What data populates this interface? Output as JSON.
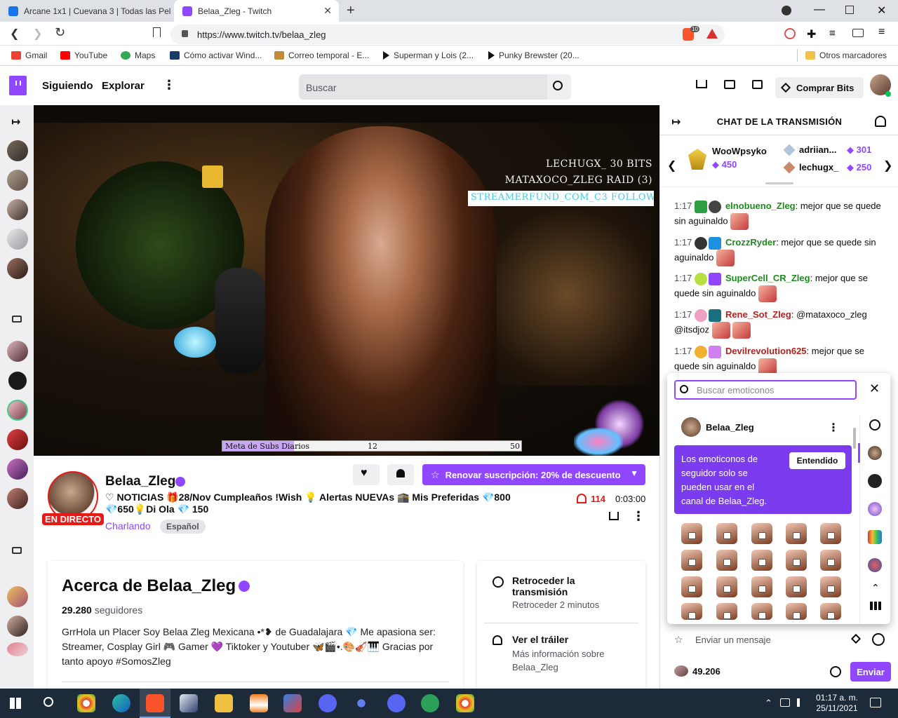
{
  "browser": {
    "tabs": [
      {
        "title": "Arcane 1x1 | Cuevana 3 | Todas las Pel"
      },
      {
        "title": "Belaa_Zleg - Twitch"
      }
    ],
    "url": "https://www.twitch.tv/belaa_zleg",
    "brave_badge": "10",
    "bookmarks": [
      "Gmail",
      "YouTube",
      "Maps",
      "Cómo activar Wind...",
      "Correo temporal - E...",
      "Superman y Lois (2...",
      "Punky Brewster (20..."
    ],
    "other_bookmarks": "Otros marcadores"
  },
  "nav": {
    "following": "Siguiendo",
    "explore": "Explorar",
    "search_placeholder": "Buscar",
    "bits_button": "Comprar Bits"
  },
  "video": {
    "overlay_line1": "LECHUGX_ 30 BITS",
    "overlay_line2": "MATAXOCO_ZLEG RAID (3)",
    "overlay_line3": "STREAMERFUND_COM_C3 FOLLOW",
    "goal_label": "Meta de Subs Diarios",
    "goal_current": "12",
    "goal_target": "50",
    "goal_fraction": 0.24
  },
  "channel": {
    "name": "Belaa_Zleg",
    "live_badge": "EN DIRECTO",
    "title_line1": "♡ NOTICIAS 🎁28/Nov Cumpleaños !Wish 💡 Alertas NUEVAs 🕋 Mis Preferidas 💎800",
    "title_line2": "💎650💡Di Ola 💎 150",
    "category": "Charlando",
    "tag": "Español",
    "viewers": "114",
    "uptime": "0:03:00",
    "subscribe_button": "Renovar suscripción: 20% de descuento"
  },
  "about": {
    "heading": "Acerca de Belaa_Zleg",
    "followers_count": "29.280",
    "followers_label": "seguidores",
    "bio": "GrrHola un Placer Soy Belaa Zleg Mexicana •*❥ de Guadalajara 💎 Me apasiona ser: Streamer, Cosplay Girl 🎮 Gamer 💜 Tiktoker y Youtuber 🦋🎬•.🎨🎻🎹 Gracias por tanto apoyo #SomosZleg"
  },
  "side_panel": {
    "rewind_title": "Retroceder la transmisión",
    "rewind_sub": "Retroceder 2 minutos",
    "trailer_title": "Ver el tráiler",
    "trailer_sub": "Más información sobre Belaa_Zleg"
  },
  "chat": {
    "header": "CHAT DE LA TRANSMISIÓN",
    "leaderboard": [
      {
        "name": "WooWpsyko",
        "amount": "450"
      },
      {
        "name": "adriian...",
        "amount": "301"
      },
      {
        "name": "lechugx_",
        "amount": "250"
      }
    ],
    "messages": [
      {
        "time": "1:17",
        "user": "elnobueno_Zleg",
        "color": "#1e8a1e",
        "text": "mejor que se quede sin aguinaldo"
      },
      {
        "time": "1:17",
        "user": "CrozzRyder",
        "color": "#1e8a1e",
        "text": "mejor que se quede sin aguinaldo"
      },
      {
        "time": "1:17",
        "user": "SuperCell_CR_Zleg",
        "color": "#1e8a1e",
        "text": "mejor que se quede sin aguinaldo"
      },
      {
        "time": "1:17",
        "user": "Rene_Sot_Zleg",
        "color": "#b22222",
        "text": "@mataxoco_zleg @itsdjoz"
      },
      {
        "time": "1:17",
        "user": "Devilrevolution625",
        "color": "#b22222",
        "text": "mejor que se quede sin aguinaldo"
      }
    ],
    "input_placeholder": "Enviar un mensaje",
    "points": "49.206",
    "send_button": "Enviar"
  },
  "emote_picker": {
    "search_placeholder": "Buscar emoticonos",
    "channel_name": "Belaa_Zleg",
    "notice": "Los emoticonos de seguidor solo se pueden usar en el canal de Belaa_Zleg.",
    "got_it": "Entendido"
  },
  "taskbar": {
    "time": "01:17 a. m.",
    "date": "25/11/2021"
  }
}
